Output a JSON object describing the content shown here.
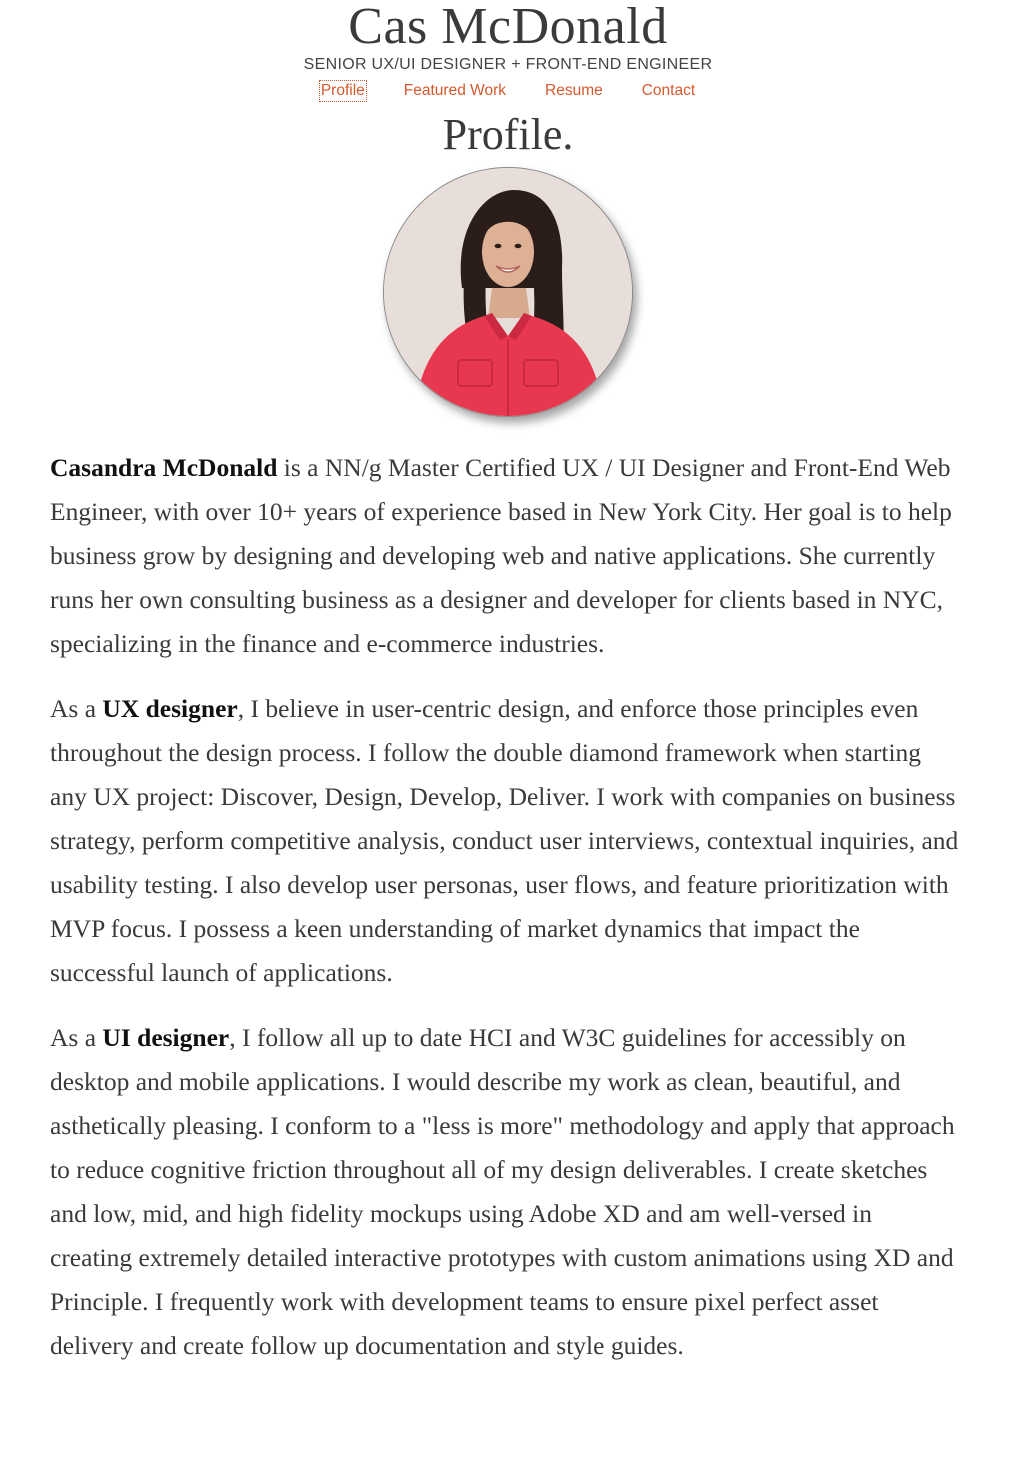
{
  "header": {
    "site_title": "Cas McDonald",
    "tagline": "SENIOR UX/UI DESIGNER + FRONT-END ENGINEER"
  },
  "nav": {
    "items": [
      {
        "label": "Profile",
        "active": true
      },
      {
        "label": "Featured Work",
        "active": false
      },
      {
        "label": "Resume",
        "active": false
      },
      {
        "label": "Contact",
        "active": false
      }
    ]
  },
  "page": {
    "title": "Profile.",
    "avatar_icon": "profile-photo"
  },
  "bio": {
    "p1": {
      "strong": "Casandra McDonald",
      "text": " is a NN/g Master Certified UX / UI Designer and Front-End Web Engineer, with over 10+ years of experience based in New York City. Her goal is to help business grow by designing and developing web and native applications. She currently runs her own consulting business as a designer and developer for clients based in NYC, specializing in the finance and e-commerce industries."
    },
    "p2": {
      "prefix": "As a ",
      "strong": "UX designer",
      "text": ", I believe in user-centric design, and enforce those principles even throughout the design process. I follow the double diamond framework when starting any UX project: Discover, Design, Develop, Deliver. I work with companies on business strategy, perform competitive analysis, conduct user interviews, contextual inquiries, and usability testing. I also develop user personas, user flows, and feature prioritization with MVP focus. I possess a keen understanding of market dynamics that impact the successful launch of applications."
    },
    "p3": {
      "prefix": "As a ",
      "strong": "UI designer",
      "text": ", I follow all up to date HCI and W3C guidelines for accessibly on desktop and mobile applications. I would describe my work as clean, beautiful, and asthetically pleasing. I conform to a \"less is more\" methodology and apply that approach to reduce cognitive friction throughout all of my design deliverables. I create sketches and low, mid, and high fidelity mockups using Adobe XD and am well-versed in creating extremely detailed interactive prototypes with custom animations using XD and Principle. I frequently work with development teams to ensure pixel perfect asset delivery and create follow up documentation and style guides."
    }
  },
  "colors": {
    "accent": "#d25a2f",
    "text": "#3a3a3a",
    "shirt": "#e8384f"
  }
}
